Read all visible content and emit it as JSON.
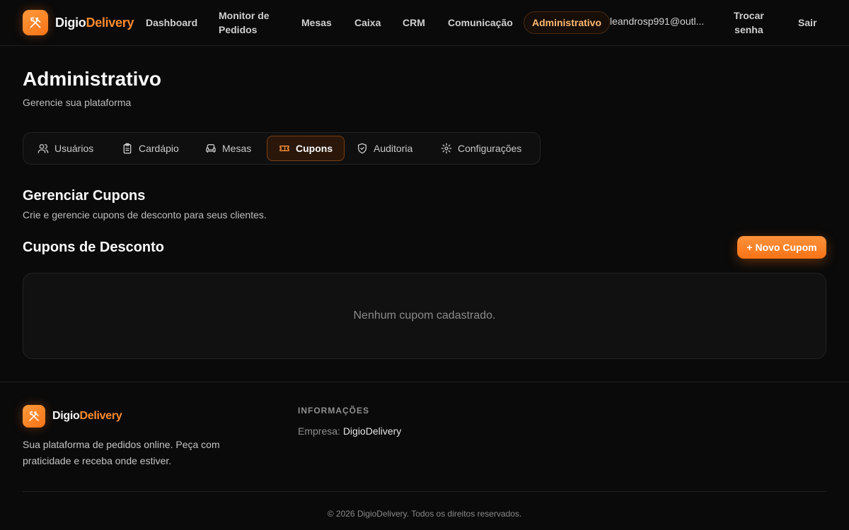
{
  "brand": {
    "name_part1": "Digio",
    "name_part2": "Delivery",
    "accent_color": "#f97316"
  },
  "nav": {
    "dashboard": "Dashboard",
    "monitor_line1": "Monitor de",
    "monitor_line2": "Pedidos",
    "mesas": "Mesas",
    "caixa": "Caixa",
    "crm": "CRM",
    "comunicacao": "Comunicação",
    "administrativo": "Administrativo",
    "user_email": "leandrosp991@outl...",
    "trocar_line1": "Trocar",
    "trocar_line2": "senha",
    "sair": "Sair"
  },
  "page": {
    "title": "Administrativo",
    "subtitle": "Gerencie sua plataforma"
  },
  "tabs": [
    {
      "label": "Usuários",
      "icon": "users-icon"
    },
    {
      "label": "Cardápio",
      "icon": "clipboard-icon"
    },
    {
      "label": "Mesas",
      "icon": "sofa-icon"
    },
    {
      "label": "Cupons",
      "icon": "ticket-icon",
      "active": true
    },
    {
      "label": "Auditoria",
      "icon": "shield-icon"
    },
    {
      "label": "Configurações",
      "icon": "gear-icon"
    }
  ],
  "coupons": {
    "section_title": "Gerenciar Cupons",
    "section_desc": "Crie e gerencie cupons de desconto para seus clientes.",
    "card_title": "Cupons de Desconto",
    "new_button": "+ Novo Cupom",
    "empty_text": "Nenhum cupom cadastrado."
  },
  "footer": {
    "description": "Sua plataforma de pedidos online. Peça com praticidade e receba onde estiver.",
    "info_heading": "INFORMAÇÕES",
    "company_label": "Empresa:",
    "company_value": "DigioDelivery",
    "copyright": "© 2026 DigioDelivery. Todos os direitos reservados."
  }
}
